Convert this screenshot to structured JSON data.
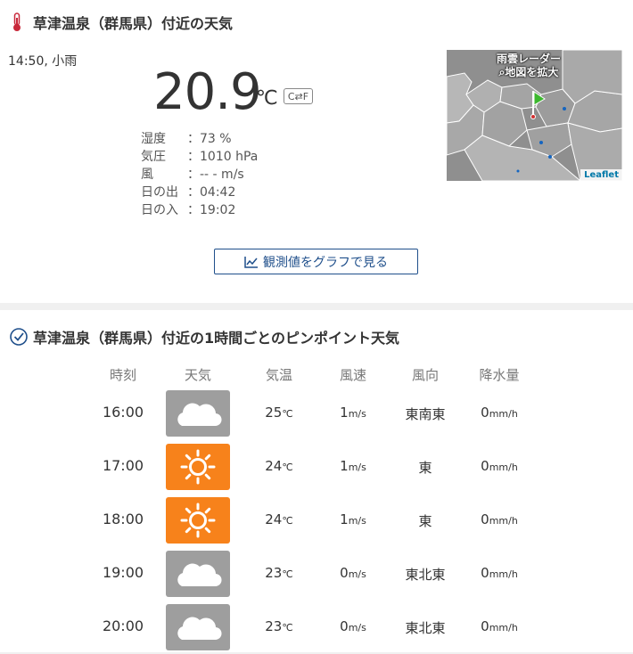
{
  "current": {
    "title": "草津温泉（群馬県）付近の天気",
    "observed": "14:50, 小雨",
    "temperature": "20.9",
    "temp_unit": "℃",
    "unit_toggle": "C⇄F",
    "details": [
      {
        "label": "湿度",
        "sep": "：",
        "value": "73 %"
      },
      {
        "label": "気圧",
        "sep": "：",
        "value": "1010 hPa"
      },
      {
        "label": "風",
        "sep": "：",
        "value": "-- - m/s"
      },
      {
        "label": "日の出",
        "sep": "：",
        "value": "04:42"
      },
      {
        "label": "日の入",
        "sep": "：",
        "value": "19:02"
      }
    ],
    "map": {
      "label_line1": "雨雲レーダー",
      "label_line2": "地図を拡大",
      "attribution": "Leaflet"
    },
    "graph_button": "観測値をグラフで見る"
  },
  "hourly": {
    "title": "草津温泉（群馬県）付近の1時間ごとのピンポイント天気",
    "headers": [
      "時刻",
      "天気",
      "気温",
      "風速",
      "風向",
      "降水量"
    ],
    "rows": [
      {
        "time": "16:00",
        "weather": "cloudy",
        "temp": "25",
        "temp_unit": "℃",
        "wind": "1",
        "wind_unit": "m/s",
        "dir": "東南東",
        "precip": "0",
        "precip_unit": "mm/h"
      },
      {
        "time": "17:00",
        "weather": "sunny",
        "temp": "24",
        "temp_unit": "℃",
        "wind": "1",
        "wind_unit": "m/s",
        "dir": "東",
        "precip": "0",
        "precip_unit": "mm/h"
      },
      {
        "time": "18:00",
        "weather": "sunny",
        "temp": "24",
        "temp_unit": "℃",
        "wind": "1",
        "wind_unit": "m/s",
        "dir": "東",
        "precip": "0",
        "precip_unit": "mm/h"
      },
      {
        "time": "19:00",
        "weather": "cloudy",
        "temp": "23",
        "temp_unit": "℃",
        "wind": "0",
        "wind_unit": "m/s",
        "dir": "東北東",
        "precip": "0",
        "precip_unit": "mm/h"
      },
      {
        "time": "20:00",
        "weather": "cloudy",
        "temp": "23",
        "temp_unit": "℃",
        "wind": "0",
        "wind_unit": "m/s",
        "dir": "東北東",
        "precip": "0",
        "precip_unit": "mm/h"
      }
    ]
  },
  "colors": {
    "cloudy_bg": "#9e9e9e",
    "sunny_bg": "#f7821b",
    "link": "#1f4f8b",
    "thermometer": "#c8283a"
  }
}
